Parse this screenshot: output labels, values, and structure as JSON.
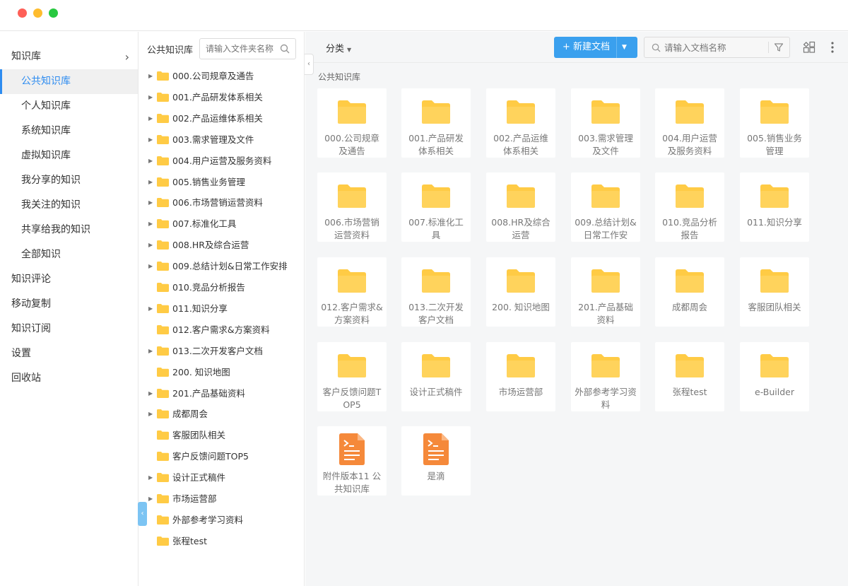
{
  "left_nav": [
    {
      "label": "知识库",
      "level": "top",
      "has_chevron": true
    },
    {
      "label": "公共知识库",
      "level": "sub",
      "active": true
    },
    {
      "label": "个人知识库",
      "level": "sub"
    },
    {
      "label": "系统知识库",
      "level": "sub"
    },
    {
      "label": "虚拟知识库",
      "level": "sub"
    },
    {
      "label": "我分享的知识",
      "level": "sub"
    },
    {
      "label": "我关注的知识",
      "level": "sub"
    },
    {
      "label": "共享给我的知识",
      "level": "sub"
    },
    {
      "label": "全部知识",
      "level": "sub"
    },
    {
      "label": "知识评论",
      "level": "top"
    },
    {
      "label": "移动复制",
      "level": "top"
    },
    {
      "label": "知识订阅",
      "level": "top"
    },
    {
      "label": "设置",
      "level": "top"
    },
    {
      "label": "回收站",
      "level": "top"
    }
  ],
  "tree": {
    "title": "公共知识库",
    "search_placeholder": "请输入文件夹名称",
    "items": [
      {
        "label": "000.公司规章及通告",
        "expandable": true
      },
      {
        "label": "001.产品研发体系相关",
        "expandable": true
      },
      {
        "label": "002.产品运维体系相关",
        "expandable": true
      },
      {
        "label": "003.需求管理及文件",
        "expandable": true
      },
      {
        "label": "004.用户运营及服务资料",
        "expandable": true
      },
      {
        "label": "005.销售业务管理",
        "expandable": true
      },
      {
        "label": "006.市场营销运营资料",
        "expandable": true
      },
      {
        "label": "007.标准化工具",
        "expandable": true
      },
      {
        "label": "008.HR及综合运营",
        "expandable": true
      },
      {
        "label": "009.总结计划&日常工作安排",
        "expandable": true
      },
      {
        "label": "010.竞品分析报告",
        "expandable": false
      },
      {
        "label": "011.知识分享",
        "expandable": true
      },
      {
        "label": "012.客户需求&方案资料",
        "expandable": false
      },
      {
        "label": "013.二次开发客户文档",
        "expandable": true
      },
      {
        "label": "200. 知识地图",
        "expandable": false
      },
      {
        "label": "201.产品基础资料",
        "expandable": true
      },
      {
        "label": "成都周会",
        "expandable": true
      },
      {
        "label": "客服团队相关",
        "expandable": false
      },
      {
        "label": "客户反馈问题TOP5",
        "expandable": false
      },
      {
        "label": "设计正式稿件",
        "expandable": true
      },
      {
        "label": "市场运营部",
        "expandable": true
      },
      {
        "label": "外部参考学习资料",
        "expandable": false
      },
      {
        "label": "张程test",
        "expandable": false
      }
    ]
  },
  "toolbar": {
    "category_label": "分类",
    "new_doc_label": "+ 新建文档",
    "doc_search_placeholder": "请输入文档名称"
  },
  "breadcrumb": "公共知识库",
  "cards": [
    {
      "label": "000.公司规章及通告",
      "type": "folder"
    },
    {
      "label": "001.产品研发体系相关",
      "type": "folder"
    },
    {
      "label": "002.产品运维体系相关",
      "type": "folder"
    },
    {
      "label": "003.需求管理及文件",
      "type": "folder"
    },
    {
      "label": "004.用户运营及服务资料",
      "type": "folder"
    },
    {
      "label": "005.销售业务管理",
      "type": "folder"
    },
    {
      "label": "006.市场营销运营资料",
      "type": "folder"
    },
    {
      "label": "007.标准化工具",
      "type": "folder"
    },
    {
      "label": "008.HR及综合运营",
      "type": "folder"
    },
    {
      "label": "009.总结计划&日常工作安",
      "type": "folder"
    },
    {
      "label": "010.竞品分析报告",
      "type": "folder"
    },
    {
      "label": "011.知识分享",
      "type": "folder"
    },
    {
      "label": "012.客户需求&方案资料",
      "type": "folder"
    },
    {
      "label": "013.二次开发客户文档",
      "type": "folder"
    },
    {
      "label": "200. 知识地图",
      "type": "folder"
    },
    {
      "label": "201.产品基础资料",
      "type": "folder"
    },
    {
      "label": "成都周会",
      "type": "folder"
    },
    {
      "label": "客服团队相关",
      "type": "folder"
    },
    {
      "label": "客户反馈问题TOP5",
      "type": "folder"
    },
    {
      "label": "设计正式稿件",
      "type": "folder"
    },
    {
      "label": "市场运营部",
      "type": "folder"
    },
    {
      "label": "外部参考学习资料",
      "type": "folder"
    },
    {
      "label": "张程test",
      "type": "folder"
    },
    {
      "label": "e-Builder",
      "type": "folder"
    },
    {
      "label": "附件版本11 公共知识库",
      "type": "document"
    },
    {
      "label": "是滴",
      "type": "document"
    }
  ],
  "colors": {
    "accent": "#2e8cf0",
    "folder": "#ffcb45",
    "document": "#f5893a",
    "primary_button": "#3aa0ee"
  }
}
